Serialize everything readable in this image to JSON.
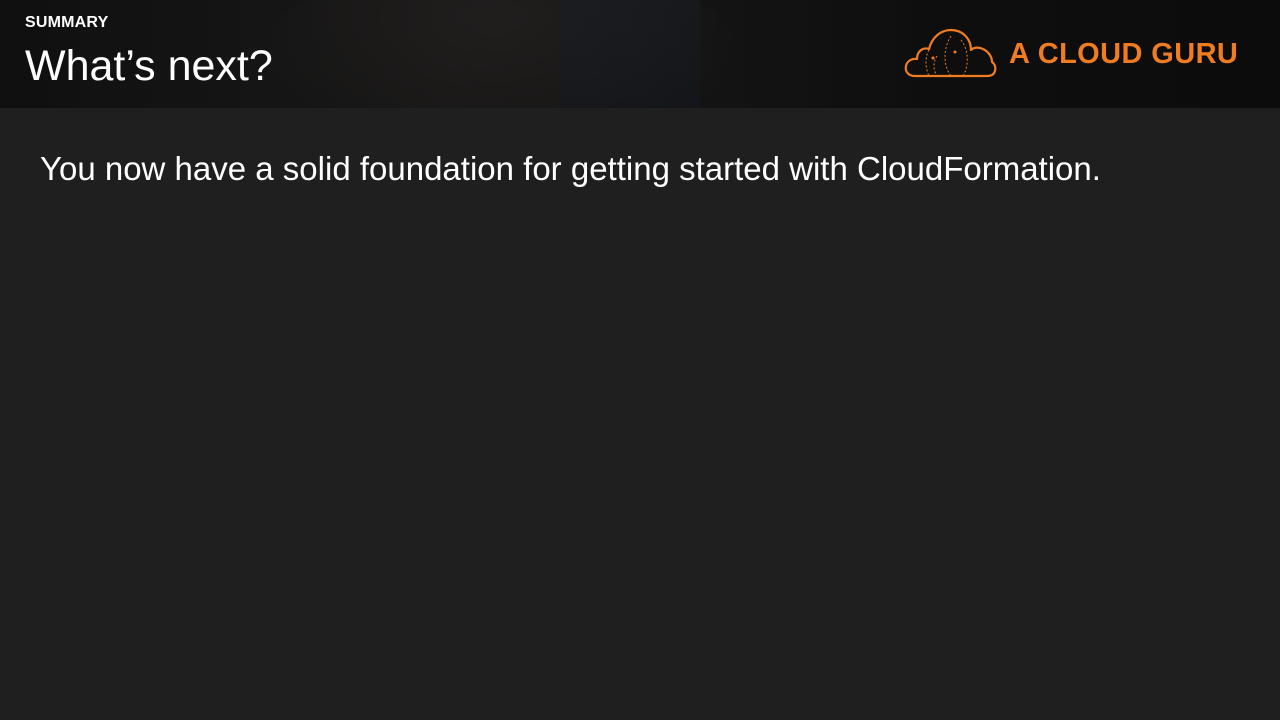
{
  "header": {
    "eyebrow": "SUMMARY",
    "title": "What’s next?"
  },
  "brand": {
    "name": "A CLOUD GURU",
    "icon": "cloud-logo-icon",
    "color": "#f07c22"
  },
  "content": {
    "body": "You now have a solid foundation for getting started with CloudFormation."
  },
  "colors": {
    "background": "#1f1f1f",
    "text": "#ffffff",
    "accent": "#f07c22"
  }
}
